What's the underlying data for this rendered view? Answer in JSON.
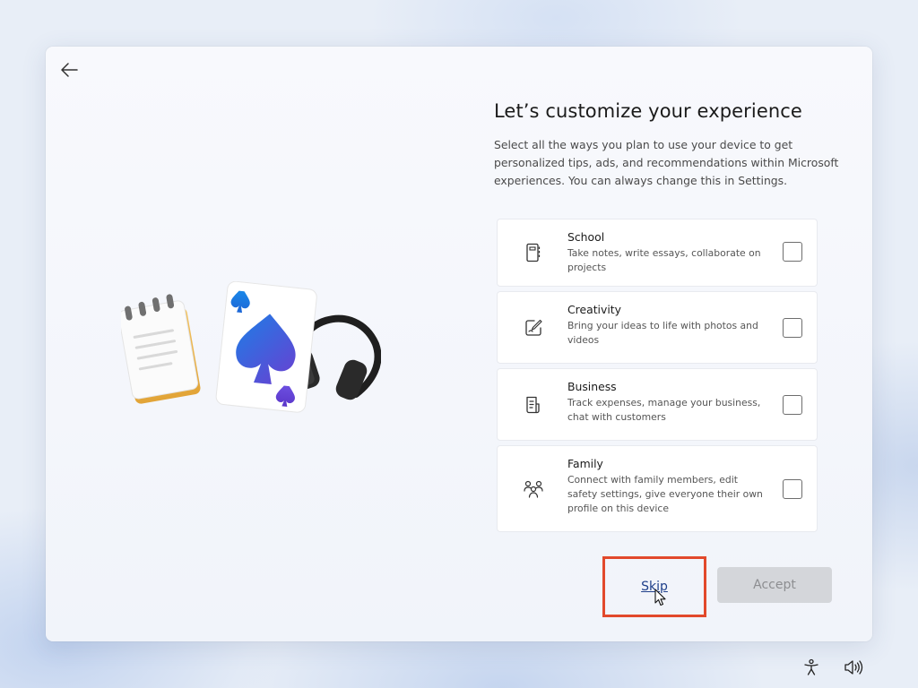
{
  "page": {
    "title": "Let’s customize your experience",
    "description": "Select all the ways you plan to use your device to get personalized tips, ads, and recommendations within Microsoft experiences. You can always change this in Settings."
  },
  "options": [
    {
      "name": "School",
      "description": "Take notes, write essays, collaborate on projects",
      "icon": "notebook-icon",
      "checked": false
    },
    {
      "name": "Creativity",
      "description": "Bring your ideas to life with photos and videos",
      "icon": "creative-edit-icon",
      "checked": false
    },
    {
      "name": "Business",
      "description": "Track expenses, manage your business, chat with customers",
      "icon": "document-icon",
      "checked": false
    },
    {
      "name": "Family",
      "description": "Connect with family members, edit safety settings, give everyone their own profile on this device",
      "icon": "people-icon",
      "checked": false
    }
  ],
  "actions": {
    "skip_label": "Skip",
    "accept_label": "Accept",
    "accept_enabled": false
  },
  "icons": {
    "back": "back-arrow-icon",
    "accessibility": "accessibility-icon",
    "volume": "volume-icon"
  },
  "colors": {
    "highlight_box": "#e2492b",
    "link": "#1f3f8a",
    "disabled_button": "#d4d6da"
  }
}
